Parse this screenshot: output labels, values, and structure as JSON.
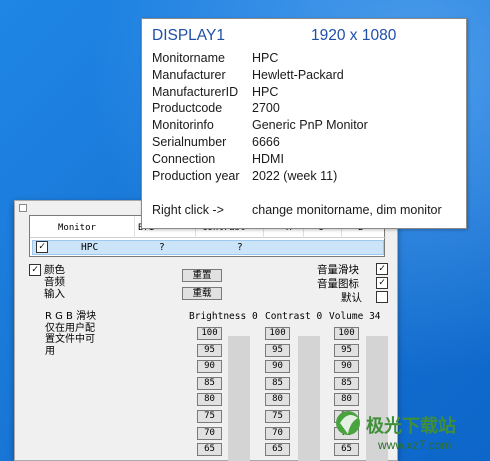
{
  "tooltip": {
    "display": "DISPLAY1",
    "resolution": "1920 x 1080",
    "rows": [
      {
        "key": "Monitorname",
        "value": "HPC"
      },
      {
        "key": "Manufacturer",
        "value": "Hewlett-Packard"
      },
      {
        "key": "ManufacturerID",
        "value": "HPC"
      },
      {
        "key": "Productcode",
        "value": "2700"
      },
      {
        "key": "Monitorinfo",
        "value": "Generic PnP Monitor"
      },
      {
        "key": "Serialnumber",
        "value": "6666"
      },
      {
        "key": "Connection",
        "value": "HDMI"
      },
      {
        "key": "Production year",
        "value": "2022 (week 11)"
      }
    ],
    "hint_key": "Right click  ->",
    "hint_value": "change monitorname, dim monitor"
  },
  "table": {
    "headers": {
      "monitor": "Monitor",
      "bri": "Bri",
      "contrast": "Contrast",
      "r": "R",
      "g": "G",
      "b": "B"
    },
    "row": {
      "checked": true,
      "name": "HPC",
      "bri": "?",
      "contrast": "?"
    }
  },
  "left_options": [
    {
      "label": "颜色",
      "checked": true
    },
    {
      "label": "音频",
      "checked": false
    },
    {
      "label": "输入",
      "checked": false
    }
  ],
  "buttons": {
    "reset": "重置",
    "reload": "重载"
  },
  "right_options": [
    {
      "label": "音量滑块",
      "checked": true
    },
    {
      "label": "音量图标",
      "checked": true
    },
    {
      "label": "默认",
      "checked": false
    }
  ],
  "rgb_note": "R G B 滑块\n仅在用户配\n置文件中可\n用",
  "sliders": [
    {
      "label": "Brightness",
      "value": "0"
    },
    {
      "label": "Contrast",
      "value": "0"
    },
    {
      "label": "Volume",
      "value": "34"
    }
  ],
  "preset_values": [
    "100",
    "95",
    "90",
    "85",
    "80",
    "75",
    "70",
    "65"
  ],
  "watermark": {
    "brand": "极光下载站",
    "url": "www.xz7.com",
    "brand_color": "#3f8f3a"
  }
}
